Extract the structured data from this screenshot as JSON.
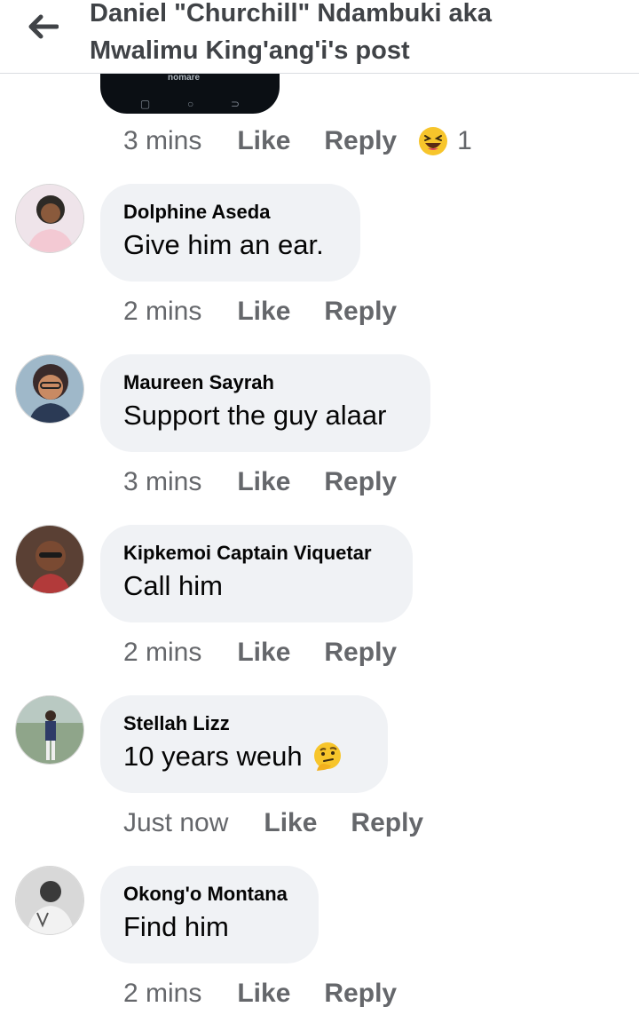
{
  "header": {
    "title_line1": "Daniel \"Churchill\" Ndambuki aka",
    "title_line2": "Mwalimu King'ang'i's post"
  },
  "media": {
    "caption": "nomare"
  },
  "top_actions": {
    "time": "3 mins",
    "like": "Like",
    "reply": "Reply",
    "reaction_count": "1"
  },
  "comments": [
    {
      "name": "Dolphine Aseda",
      "text": "Give him an ear.",
      "time": "2 mins",
      "like": "Like",
      "reply": "Reply"
    },
    {
      "name": "Maureen Sayrah",
      "text": "Support the guy alaar",
      "time": "3 mins",
      "like": "Like",
      "reply": "Reply"
    },
    {
      "name": "Kipkemoi Captain Viquetar",
      "text": "Call him",
      "time": "2 mins",
      "like": "Like",
      "reply": "Reply"
    },
    {
      "name": "Stellah Lizz",
      "text": "10 years weuh",
      "time": "Just now",
      "like": "Like",
      "reply": "Reply",
      "emoji": "thinking-face-icon"
    },
    {
      "name": "Okong'o Montana",
      "text": "Find him",
      "time": "2 mins",
      "like": "Like",
      "reply": "Reply"
    }
  ]
}
